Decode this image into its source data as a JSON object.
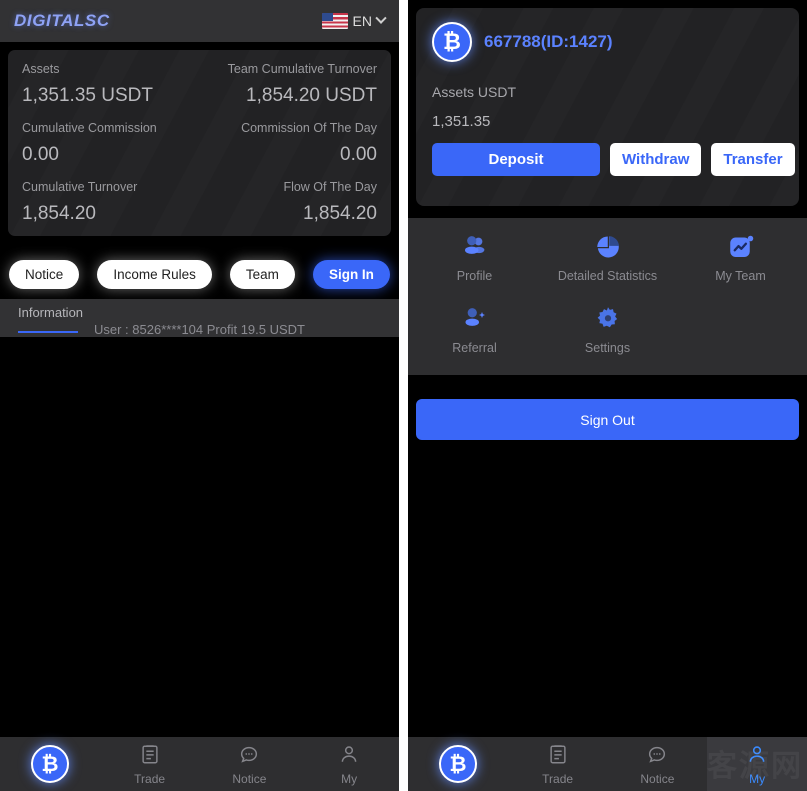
{
  "left": {
    "header": {
      "brand": "DIGITALSC",
      "language_label": "EN",
      "flag_icon": "us-flag-icon",
      "chevron_icon": "chevron-down-icon"
    },
    "stats": [
      {
        "label": "Assets",
        "value": "1,351.35 USDT"
      },
      {
        "label": "Team Cumulative Turnover",
        "value": "1,854.20 USDT"
      },
      {
        "label": "Cumulative Commission",
        "value": "0.00"
      },
      {
        "label": "Commission Of The Day",
        "value": "0.00"
      },
      {
        "label": "Cumulative Turnover",
        "value": "1,854.20"
      },
      {
        "label": "Flow Of The Day",
        "value": "1,854.20"
      }
    ],
    "buttons": [
      {
        "label": "Notice",
        "style": "white"
      },
      {
        "label": "Income Rules",
        "style": "white"
      },
      {
        "label": "Team",
        "style": "white"
      },
      {
        "label": "Sign In",
        "style": "primary"
      }
    ],
    "info": {
      "tab_label": "Information",
      "ticker_text": "User : 8526****104 Profit 19.5 USDT"
    }
  },
  "right": {
    "account": {
      "avatar_icon": "bitcoin-icon",
      "name": "667788(ID:1427)",
      "assets_label": "Assets USDT",
      "assets_value": "1,351.35",
      "actions": [
        {
          "label": "Deposit",
          "style": "filled"
        },
        {
          "label": "Withdraw",
          "style": "outline"
        },
        {
          "label": "Transfer",
          "style": "outline"
        }
      ]
    },
    "menu": [
      {
        "label": "Profile",
        "icon": "people-icon"
      },
      {
        "label": "Detailed Statistics",
        "icon": "pie-chart-icon"
      },
      {
        "label": "My Team",
        "icon": "trend-chart-icon"
      },
      {
        "label": "Referral",
        "icon": "add-person-icon"
      },
      {
        "label": "Settings",
        "icon": "gear-icon"
      }
    ],
    "sign_out_label": "Sign Out"
  },
  "bottom_nav_left": [
    {
      "label": "",
      "icon": "bitcoin-icon",
      "active": false
    },
    {
      "label": "Trade",
      "icon": "clipboard-icon",
      "active": false
    },
    {
      "label": "Notice",
      "icon": "chat-bubble-icon",
      "active": false
    },
    {
      "label": "My",
      "icon": "person-icon",
      "active": false
    }
  ],
  "bottom_nav_right": [
    {
      "label": "",
      "icon": "bitcoin-icon",
      "active": false
    },
    {
      "label": "Trade",
      "icon": "clipboard-icon",
      "active": false
    },
    {
      "label": "Notice",
      "icon": "chat-bubble-icon",
      "active": false
    },
    {
      "label": "My",
      "icon": "person-icon",
      "active": true
    }
  ],
  "watermark": "客源网",
  "colors": {
    "accent": "#3a67f8",
    "active_nav": "#3a8bff",
    "card_bg": "#222224",
    "panel_bg": "#2e2e30",
    "brand_text": "#8ea2f5"
  }
}
